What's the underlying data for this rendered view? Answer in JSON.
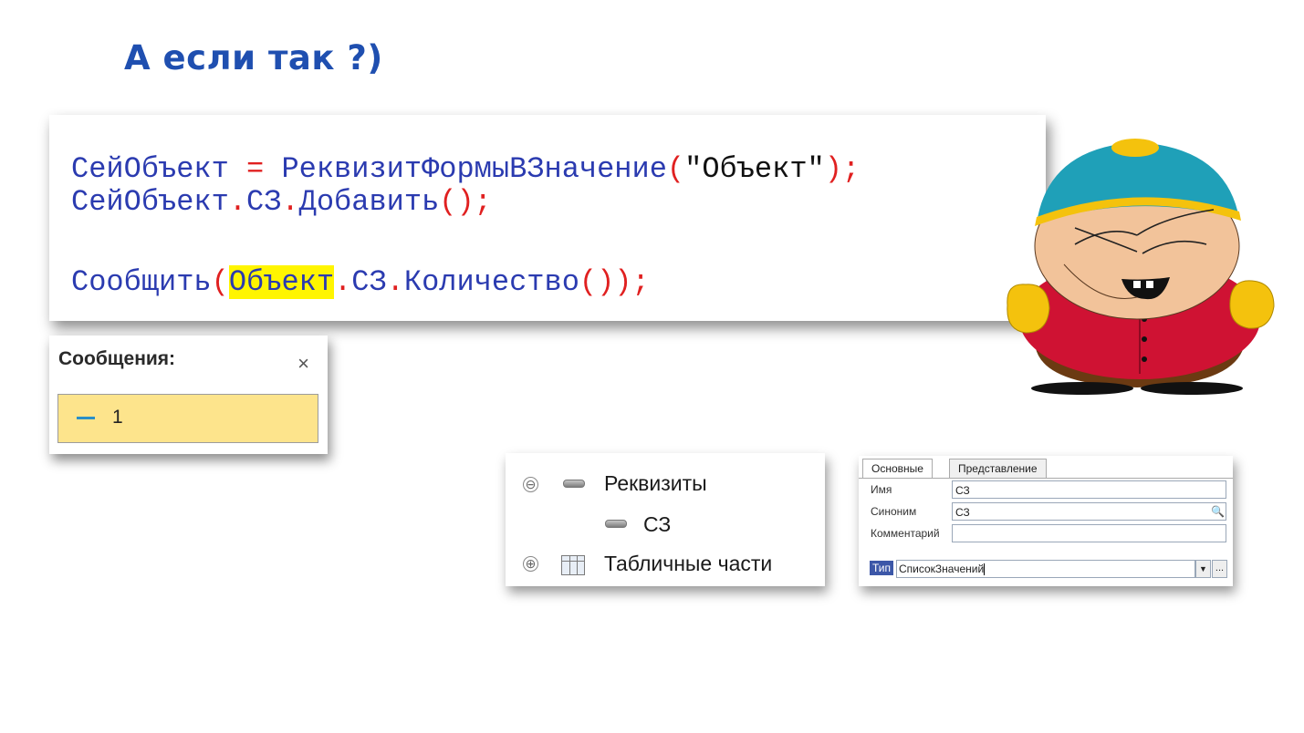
{
  "slide": {
    "title": "А если так ?)"
  },
  "code": {
    "line1": {
      "a": "СейОбъект",
      "b": " = ",
      "c": "РеквизитФормыВЗначение",
      "d": "(",
      "e": "\"Объект\"",
      "f": ");"
    },
    "line2": {
      "a": "СейОбъект",
      "b": ".",
      "c": "СЗ",
      "d": ".",
      "e": "Добавить",
      "f": "();"
    },
    "line3": {
      "a": "Сообщить",
      "b": "(",
      "c": "Объект",
      "d": ".",
      "e": "СЗ",
      "f": ".",
      "g": "Количество",
      "h": "());"
    },
    "colors": {
      "identifier": "#2b3bb0",
      "operator": "#e02020",
      "highlight": "#fff500"
    }
  },
  "messages": {
    "title": "Сообщения:",
    "close": "×",
    "items": [
      {
        "text": "1"
      }
    ],
    "item_bg": "#fde48c"
  },
  "tree": {
    "items": [
      {
        "label": "Реквизиты",
        "toggle": "⊖"
      },
      {
        "label": "СЗ"
      },
      {
        "label": "Табличные части",
        "toggle": "⊕"
      }
    ]
  },
  "properties": {
    "tabs": [
      "Основные",
      "Представление"
    ],
    "name_label": "Имя",
    "name_value": "СЗ",
    "synonym_label": "Синоним",
    "synonym_value": "СЗ",
    "comment_label": "Комментарий",
    "comment_value": "",
    "type_label": "Тип",
    "type_value": "СписокЗначений",
    "type_drop": "▼",
    "type_more": "...",
    "search_glyph": "🔍"
  },
  "illustration": {
    "icon": "cartman-character"
  }
}
